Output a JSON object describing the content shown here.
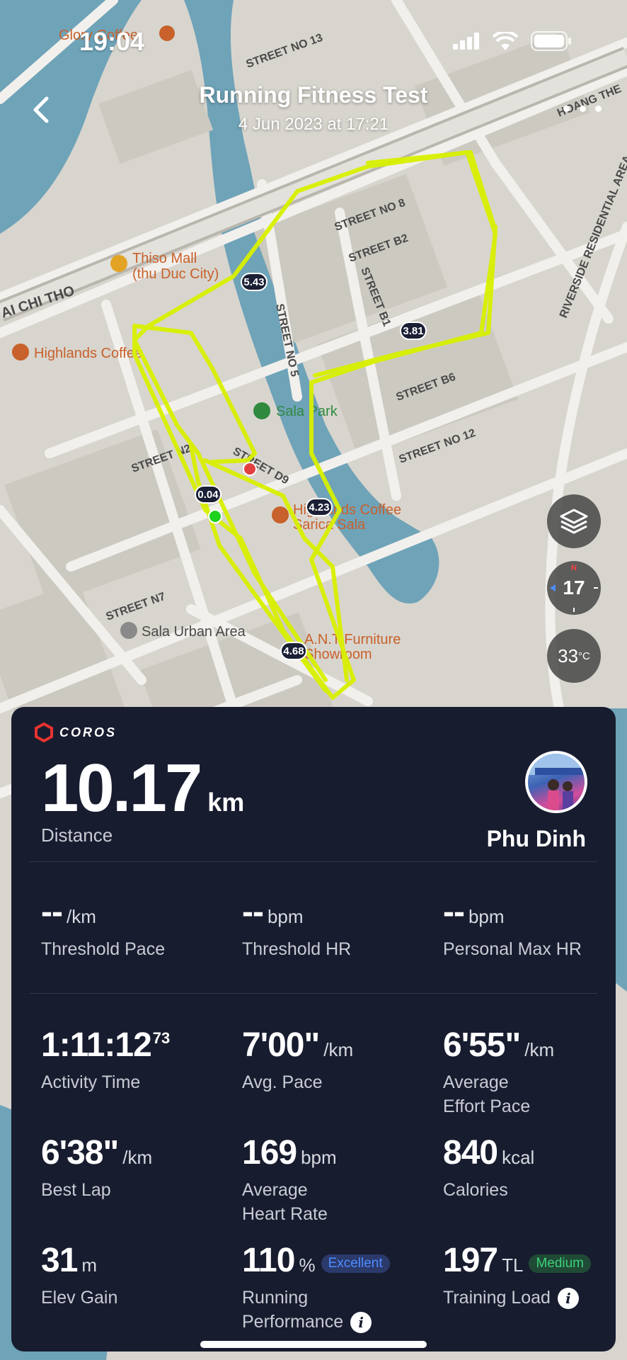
{
  "status_bar": {
    "time": "19:04"
  },
  "nav": {
    "title": "Running Fitness Test",
    "subtitle": "4 Jun 2023 at 17:21"
  },
  "map": {
    "labels": {
      "glory_coffee": "Glory Coffee",
      "street_no_13": "STREET NO 13",
      "hoang_the": "HOANG THE",
      "riverside": "RIVERSIDE RESIDENTIAL AREA",
      "street_no_8": "STREET NO 8",
      "street_b2": "STREET B2",
      "street_b1": "STREET B1",
      "thiso_mall_1": "Thiso Mall",
      "thiso_mall_2": "(thu Duc City)",
      "mai_chi_tho": "AI CHI THO",
      "highlands_1": "Highlands Coffee",
      "street_no_5": "STREET NO 5",
      "street_b6": "STREET B6",
      "sala_park": "Sala Park",
      "street_no_12": "STREET NO 12",
      "street_n2": "STREET N2",
      "street_d9": "STREET D9",
      "highlands_2a": "Highlands Coffee",
      "highlands_2b": "Sarica Sala",
      "street_n7": "STREET N7",
      "sala_urban": "Sala Urban Area",
      "furniture_1": "A.N.T Furniture",
      "furniture_2": "Showroom"
    },
    "markers": {
      "km1": "5.43",
      "km2": "3.81",
      "km3": "0.04",
      "km4": "4.23",
      "km5": "4.68"
    },
    "compass": "17",
    "temperature": "33",
    "temperature_unit": "°C",
    "route_color": "#d8f000"
  },
  "panel": {
    "brand": "COROS",
    "distance": {
      "value": "10.17",
      "unit": "km",
      "label": "Distance"
    },
    "user": {
      "name": "Phu Dinh"
    },
    "thresholds": [
      {
        "value": "--",
        "unit": "/km",
        "label": "Threshold Pace"
      },
      {
        "value": "--",
        "unit": "bpm",
        "label": "Threshold HR"
      },
      {
        "value": "--",
        "unit": "bpm",
        "label": "Personal Max HR"
      }
    ],
    "stats": {
      "activity_time": {
        "value": "1:11:12",
        "sup": "73",
        "label": "Activity Time"
      },
      "avg_pace": {
        "value": "7'00\"",
        "unit": "/km",
        "label": "Avg. Pace"
      },
      "effort_pace": {
        "value": "6'55\"",
        "unit": "/km",
        "label1": "Average",
        "label2": "Effort Pace"
      },
      "best_lap": {
        "value": "6'38\"",
        "unit": "/km",
        "label": "Best Lap"
      },
      "avg_hr": {
        "value": "169",
        "unit": "bpm",
        "label1": "Average",
        "label2": "Heart Rate"
      },
      "calories": {
        "value": "840",
        "unit": "kcal",
        "label": "Calories"
      },
      "elev_gain": {
        "value": "31",
        "unit": "m",
        "label": "Elev Gain"
      },
      "running_perf": {
        "value": "110",
        "unit": "%",
        "badge": "Excellent",
        "label1": "Running",
        "label2": "Performance"
      },
      "training_load": {
        "value": "197",
        "unit": "TL",
        "badge": "Medium",
        "label": "Training Load"
      }
    },
    "colors": {
      "background": "#181c2f",
      "accent_blue": "#4e8cff",
      "accent_green": "#3ed07a",
      "brand_red": "#e8322f"
    }
  }
}
